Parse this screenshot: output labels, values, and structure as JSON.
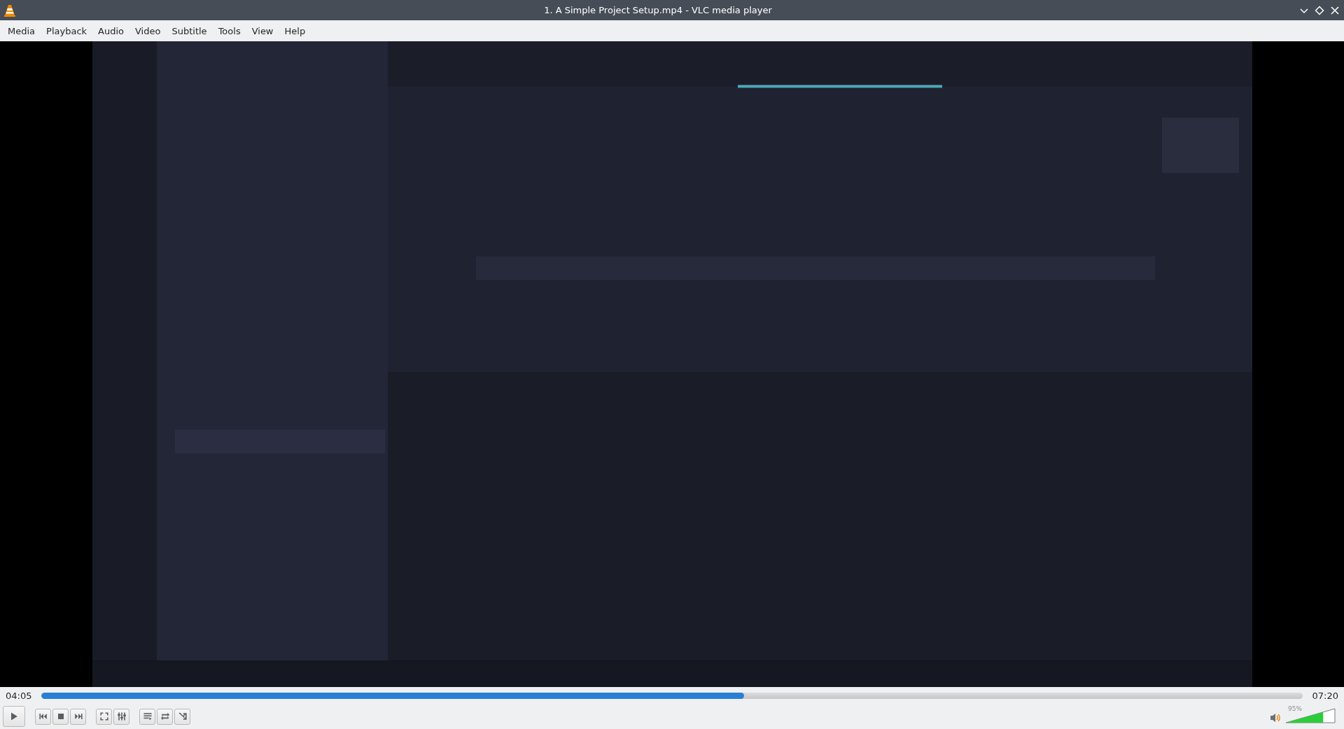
{
  "window": {
    "title": "1. A Simple Project Setup.mp4 - VLC media player"
  },
  "menu": [
    "Media",
    "Playback",
    "Audio",
    "Video",
    "Subtitle",
    "Tools",
    "View",
    "Help"
  ],
  "video": {
    "kind": "picture"
  },
  "playback": {
    "elapsed": "04:05",
    "total": "07:20",
    "level": 0.557
  },
  "control_groups": [
    [
      {
        "kind": "play"
      }
    ],
    [
      {
        "kind": "previous"
      },
      {
        "kind": "stop"
      },
      {
        "kind": "next"
      }
    ],
    [
      {
        "kind": "fullscreen"
      },
      {
        "kind": "extended"
      }
    ],
    [
      {
        "kind": "playlist"
      },
      {
        "kind": "loop"
      },
      {
        "kind": "shuffle"
      }
    ]
  ],
  "volume": {
    "reading": "95%",
    "level": 0.76
  }
}
